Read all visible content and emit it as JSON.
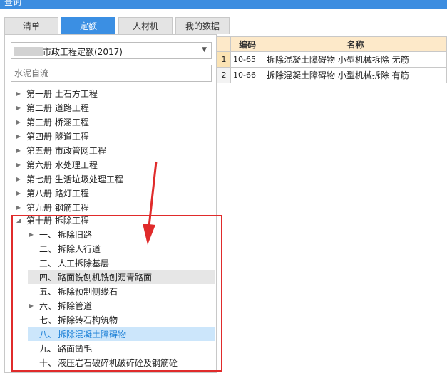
{
  "window": {
    "title": "查询"
  },
  "tabs": [
    {
      "label": "清单",
      "active": false
    },
    {
      "label": "定额",
      "active": true
    },
    {
      "label": "人材机",
      "active": false
    },
    {
      "label": "我的数据",
      "active": false
    }
  ],
  "quota_select": {
    "value": "市政工程定额(2017)"
  },
  "search": {
    "value": "水泥自流"
  },
  "tree": {
    "volumes": [
      {
        "label": "第一册  土石方工程",
        "expanded": false
      },
      {
        "label": "第二册  道路工程",
        "expanded": false
      },
      {
        "label": "第三册  桥涵工程",
        "expanded": false
      },
      {
        "label": "第四册  隧道工程",
        "expanded": false
      },
      {
        "label": "第五册  市政管网工程",
        "expanded": false
      },
      {
        "label": "第六册  水处理工程",
        "expanded": false
      },
      {
        "label": "第七册  生活垃圾处理工程",
        "expanded": false
      },
      {
        "label": "第八册  路灯工程",
        "expanded": false
      },
      {
        "label": "第九册  钢筋工程",
        "expanded": false
      },
      {
        "label": "第十册  拆除工程",
        "expanded": true
      }
    ],
    "children": [
      {
        "index": "一、",
        "label": "拆除旧路",
        "has_children": true
      },
      {
        "index": "二、",
        "label": "拆除人行道",
        "has_children": false
      },
      {
        "index": "三、",
        "label": "人工拆除基层",
        "has_children": false
      },
      {
        "index": "四、",
        "label": "路面铣刨机铣刨沥青路面",
        "has_children": false,
        "state": "hover"
      },
      {
        "index": "五、",
        "label": "拆除预制侧缘石",
        "has_children": false
      },
      {
        "index": "六、",
        "label": "拆除管道",
        "has_children": true
      },
      {
        "index": "七、",
        "label": "拆除砖石构筑物",
        "has_children": false
      },
      {
        "index": "八、",
        "label": "拆除混凝土障碍物",
        "has_children": false,
        "state": "selected"
      },
      {
        "index": "九、",
        "label": "路面凿毛",
        "has_children": false
      },
      {
        "index": "十、",
        "label": "液压岩石破碎机破碎砼及钢筋砼",
        "has_children": false
      }
    ]
  },
  "grid": {
    "columns": [
      "编码",
      "名称"
    ],
    "rows": [
      {
        "n": "1",
        "code": "10-65",
        "name": "拆除混凝土障碍物  小型机械拆除  无筋"
      },
      {
        "n": "2",
        "code": "10-66",
        "name": "拆除混凝土障碍物  小型机械拆除  有筋"
      }
    ]
  },
  "colors": {
    "tab_active": "#3b8fe3",
    "highlight_box": "#e02b2b",
    "grid_header": "#fde9c9",
    "selected_row": "#cce6fb"
  }
}
